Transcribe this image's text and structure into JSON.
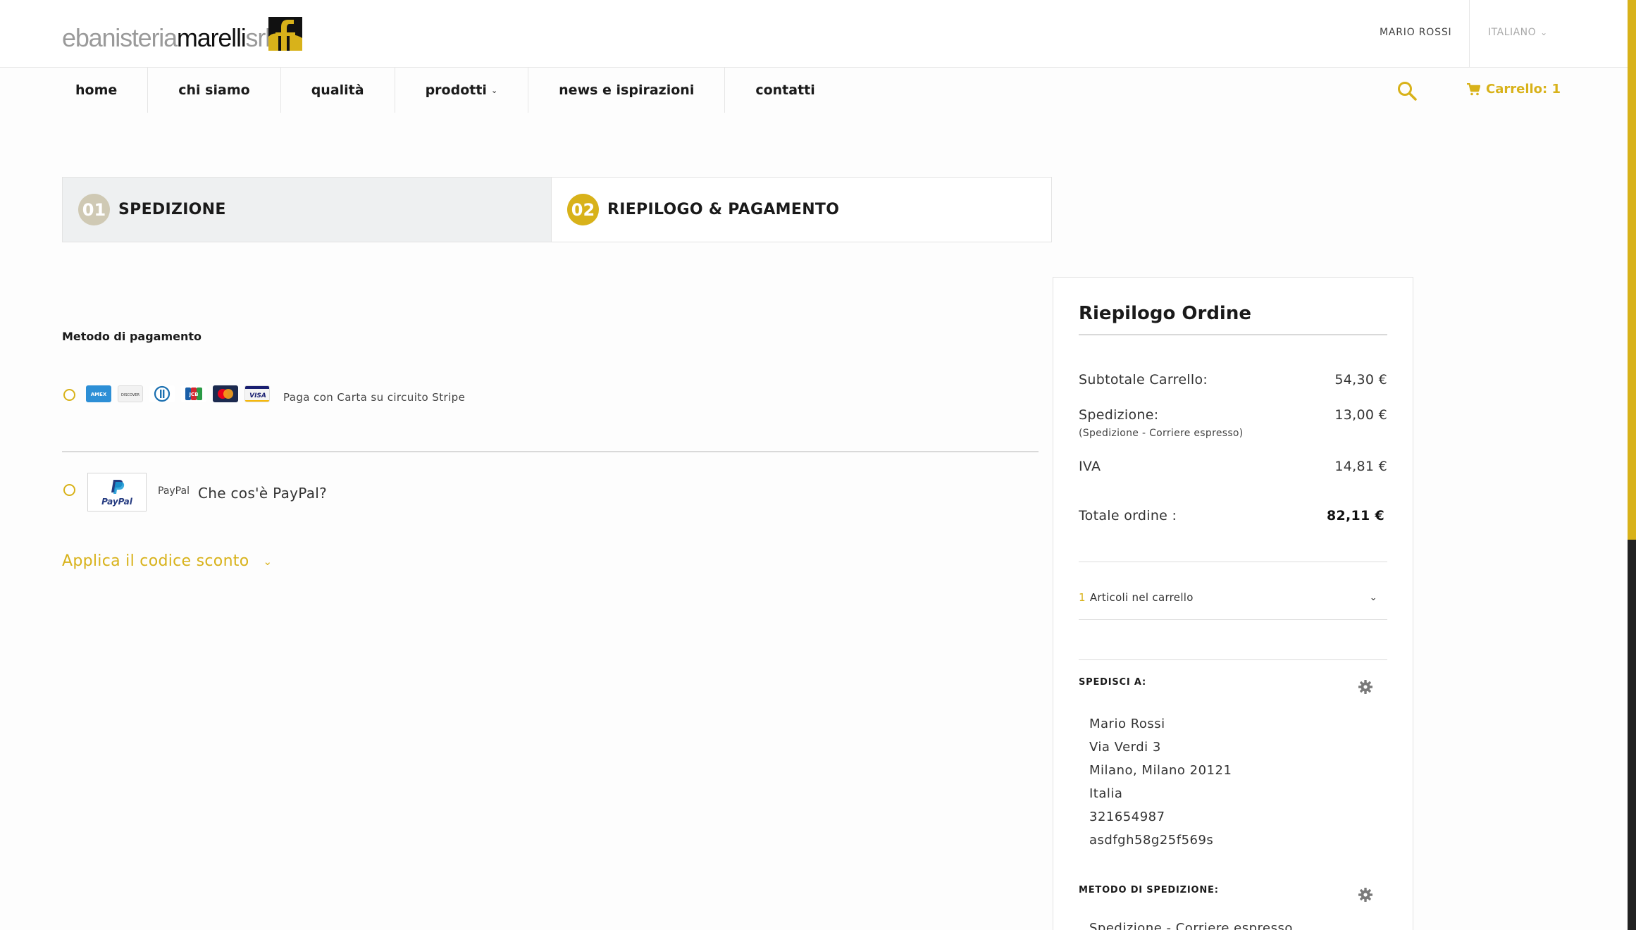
{
  "header": {
    "logo": {
      "part1": "ebanisteria",
      "part2": "marelli",
      "part3": "srl"
    },
    "user_name": "MARIO ROSSI",
    "language": "ITALIANO"
  },
  "nav": {
    "items": [
      {
        "label": "home"
      },
      {
        "label": "chi siamo"
      },
      {
        "label": "qualità"
      },
      {
        "label": "prodotti"
      },
      {
        "label": "news e ispirazioni"
      },
      {
        "label": "contatti"
      }
    ],
    "cart_label": "Carrello: 1"
  },
  "steps": [
    {
      "num": "01",
      "label": "SPEDIZIONE"
    },
    {
      "num": "02",
      "label": "RIEPILOGO & PAGAMENTO"
    }
  ],
  "payment": {
    "title": "Metodo di pagamento",
    "cards": [
      "AMEX",
      "DISCOVER",
      "DINERS",
      "JCB",
      "MASTERCARD",
      "VISA"
    ],
    "stripe_label": "Paga con Carta su circuito Stripe",
    "paypal_logo_text": "PayPal",
    "paypal_small": "PayPal",
    "paypal_link": "Che cos'è PayPal?",
    "coupon_label": "Applica il codice sconto"
  },
  "summary": {
    "title": "Riepilogo Ordine",
    "subtotal_label": "Subtotale Carrello:",
    "subtotal_value": "54,30 €",
    "shipping_label": "Spedizione:",
    "shipping_sub": "(Spedizione - Corriere espresso)",
    "shipping_value": "13,00 €",
    "iva_label": "IVA",
    "iva_value": "14,81 €",
    "total_label": "Totale ordine :",
    "total_value": "82,11 €",
    "items_count": "1",
    "items_label": "Articoli nel carrello",
    "ship_to_title": "SPEDISCI A:",
    "address": {
      "name": "Mario Rossi",
      "street": "Via Verdi 3",
      "city": "Milano, Milano 20121",
      "country": "Italia",
      "phone": "321654987",
      "extra": "asdfgh58g25f569s"
    },
    "ship_method_title": "METODO DI SPEDIZIONE:",
    "ship_method_value": "Spedizione - Corriere espresso"
  },
  "colors": {
    "accent": "#d8b21a",
    "step1_circle": "#cfc9b4",
    "step1_bg": "#eef0f1",
    "text": "#1a1a1a"
  }
}
